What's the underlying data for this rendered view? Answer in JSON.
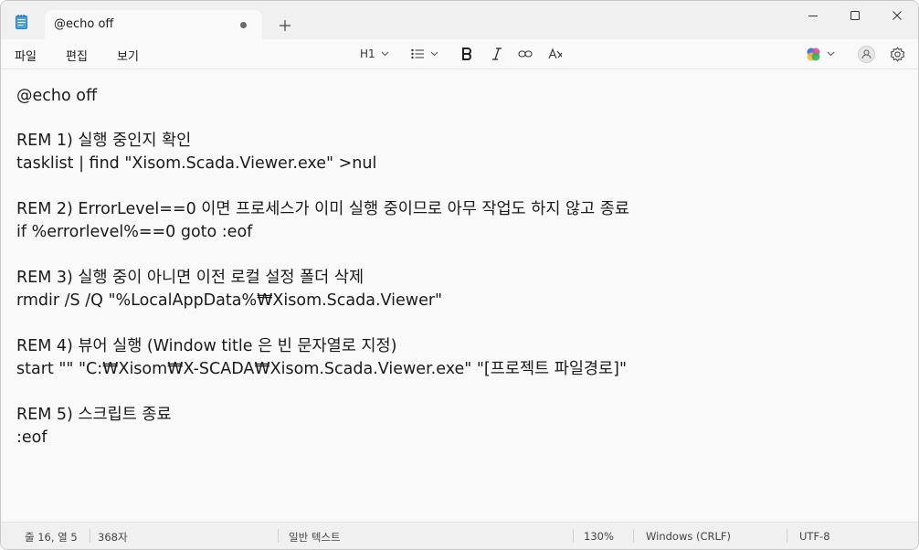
{
  "window": {
    "tab_title": "@echo off"
  },
  "menu": {
    "file": "파일",
    "edit": "편집",
    "view": "보기"
  },
  "format_toolbar": {
    "heading_label": "H1"
  },
  "editor": {
    "lines": [
      "@echo off",
      "",
      "REM 1) 실행 중인지 확인",
      "tasklist | find \"Xisom.Scada.Viewer.exe\" >nul",
      "",
      "REM 2) ErrorLevel==0 이면 프로세스가 이미 실행 중이므로 아무 작업도 하지 않고 종료",
      "if %errorlevel%==0 goto :eof",
      "",
      "REM 3) 실행 중이 아니면 이전 로컬 설정 폴더 삭제",
      "rmdir /S /Q \"%LocalAppData%₩Xisom.Scada.Viewer\"",
      "",
      "REM 4) 뷰어 실행 (Window title 은 빈 문자열로 지정)",
      "start \"\" \"C:₩Xisom₩X-SCADA₩Xisom.Scada.Viewer.exe\" \"[프로젝트 파일경로]\"",
      "",
      "REM 5) 스크립트 종료",
      ":eof"
    ]
  },
  "status": {
    "position": "줄 16, 열 5",
    "char_count": "368자",
    "text_mode": "일반 텍스트",
    "zoom": "130%",
    "line_ending": "Windows (CRLF)",
    "encoding": "UTF-8"
  }
}
